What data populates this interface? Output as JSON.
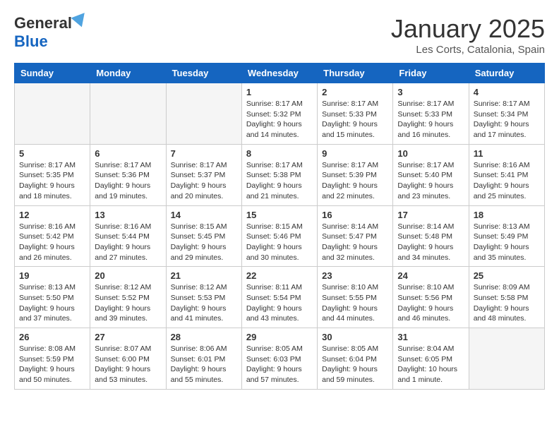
{
  "header": {
    "logo_general": "General",
    "logo_blue": "Blue",
    "month_title": "January 2025",
    "location": "Les Corts, Catalonia, Spain"
  },
  "weekdays": [
    "Sunday",
    "Monday",
    "Tuesday",
    "Wednesday",
    "Thursday",
    "Friday",
    "Saturday"
  ],
  "weeks": [
    [
      {
        "day": "",
        "empty": true
      },
      {
        "day": "",
        "empty": true
      },
      {
        "day": "",
        "empty": true
      },
      {
        "day": "1",
        "sunrise": "8:17 AM",
        "sunset": "5:32 PM",
        "daylight": "9 hours and 14 minutes."
      },
      {
        "day": "2",
        "sunrise": "8:17 AM",
        "sunset": "5:33 PM",
        "daylight": "9 hours and 15 minutes."
      },
      {
        "day": "3",
        "sunrise": "8:17 AM",
        "sunset": "5:33 PM",
        "daylight": "9 hours and 16 minutes."
      },
      {
        "day": "4",
        "sunrise": "8:17 AM",
        "sunset": "5:34 PM",
        "daylight": "9 hours and 17 minutes."
      }
    ],
    [
      {
        "day": "5",
        "sunrise": "8:17 AM",
        "sunset": "5:35 PM",
        "daylight": "9 hours and 18 minutes."
      },
      {
        "day": "6",
        "sunrise": "8:17 AM",
        "sunset": "5:36 PM",
        "daylight": "9 hours and 19 minutes."
      },
      {
        "day": "7",
        "sunrise": "8:17 AM",
        "sunset": "5:37 PM",
        "daylight": "9 hours and 20 minutes."
      },
      {
        "day": "8",
        "sunrise": "8:17 AM",
        "sunset": "5:38 PM",
        "daylight": "9 hours and 21 minutes."
      },
      {
        "day": "9",
        "sunrise": "8:17 AM",
        "sunset": "5:39 PM",
        "daylight": "9 hours and 22 minutes."
      },
      {
        "day": "10",
        "sunrise": "8:17 AM",
        "sunset": "5:40 PM",
        "daylight": "9 hours and 23 minutes."
      },
      {
        "day": "11",
        "sunrise": "8:16 AM",
        "sunset": "5:41 PM",
        "daylight": "9 hours and 25 minutes."
      }
    ],
    [
      {
        "day": "12",
        "sunrise": "8:16 AM",
        "sunset": "5:42 PM",
        "daylight": "9 hours and 26 minutes."
      },
      {
        "day": "13",
        "sunrise": "8:16 AM",
        "sunset": "5:44 PM",
        "daylight": "9 hours and 27 minutes."
      },
      {
        "day": "14",
        "sunrise": "8:15 AM",
        "sunset": "5:45 PM",
        "daylight": "9 hours and 29 minutes."
      },
      {
        "day": "15",
        "sunrise": "8:15 AM",
        "sunset": "5:46 PM",
        "daylight": "9 hours and 30 minutes."
      },
      {
        "day": "16",
        "sunrise": "8:14 AM",
        "sunset": "5:47 PM",
        "daylight": "9 hours and 32 minutes."
      },
      {
        "day": "17",
        "sunrise": "8:14 AM",
        "sunset": "5:48 PM",
        "daylight": "9 hours and 34 minutes."
      },
      {
        "day": "18",
        "sunrise": "8:13 AM",
        "sunset": "5:49 PM",
        "daylight": "9 hours and 35 minutes."
      }
    ],
    [
      {
        "day": "19",
        "sunrise": "8:13 AM",
        "sunset": "5:50 PM",
        "daylight": "9 hours and 37 minutes."
      },
      {
        "day": "20",
        "sunrise": "8:12 AM",
        "sunset": "5:52 PM",
        "daylight": "9 hours and 39 minutes."
      },
      {
        "day": "21",
        "sunrise": "8:12 AM",
        "sunset": "5:53 PM",
        "daylight": "9 hours and 41 minutes."
      },
      {
        "day": "22",
        "sunrise": "8:11 AM",
        "sunset": "5:54 PM",
        "daylight": "9 hours and 43 minutes."
      },
      {
        "day": "23",
        "sunrise": "8:10 AM",
        "sunset": "5:55 PM",
        "daylight": "9 hours and 44 minutes."
      },
      {
        "day": "24",
        "sunrise": "8:10 AM",
        "sunset": "5:56 PM",
        "daylight": "9 hours and 46 minutes."
      },
      {
        "day": "25",
        "sunrise": "8:09 AM",
        "sunset": "5:58 PM",
        "daylight": "9 hours and 48 minutes."
      }
    ],
    [
      {
        "day": "26",
        "sunrise": "8:08 AM",
        "sunset": "5:59 PM",
        "daylight": "9 hours and 50 minutes."
      },
      {
        "day": "27",
        "sunrise": "8:07 AM",
        "sunset": "6:00 PM",
        "daylight": "9 hours and 53 minutes."
      },
      {
        "day": "28",
        "sunrise": "8:06 AM",
        "sunset": "6:01 PM",
        "daylight": "9 hours and 55 minutes."
      },
      {
        "day": "29",
        "sunrise": "8:05 AM",
        "sunset": "6:03 PM",
        "daylight": "9 hours and 57 minutes."
      },
      {
        "day": "30",
        "sunrise": "8:05 AM",
        "sunset": "6:04 PM",
        "daylight": "9 hours and 59 minutes."
      },
      {
        "day": "31",
        "sunrise": "8:04 AM",
        "sunset": "6:05 PM",
        "daylight": "10 hours and 1 minute."
      },
      {
        "day": "",
        "empty": true
      }
    ]
  ],
  "labels": {
    "sunrise_prefix": "Sunrise: ",
    "sunset_prefix": "Sunset: ",
    "daylight_prefix": "Daylight: "
  }
}
